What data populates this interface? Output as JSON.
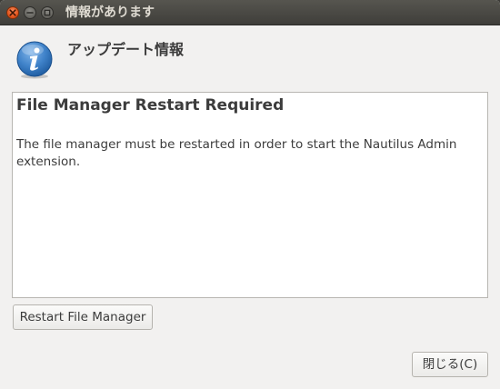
{
  "window": {
    "title": "情報があります"
  },
  "dialog": {
    "heading": "アップデート情報",
    "icon": "info-icon",
    "message_title": "File Manager Restart Required",
    "message_body": "The file manager must be restarted in order to start the Nautilus Admin extension."
  },
  "buttons": {
    "restart_label": "Restart File Manager",
    "close_label": "閉じる(C)"
  },
  "colors": {
    "titlebar": "#3f3e3a",
    "close_button": "#e5561e",
    "background": "#f2f1f0",
    "icon_blue": "#2a6fb5"
  }
}
